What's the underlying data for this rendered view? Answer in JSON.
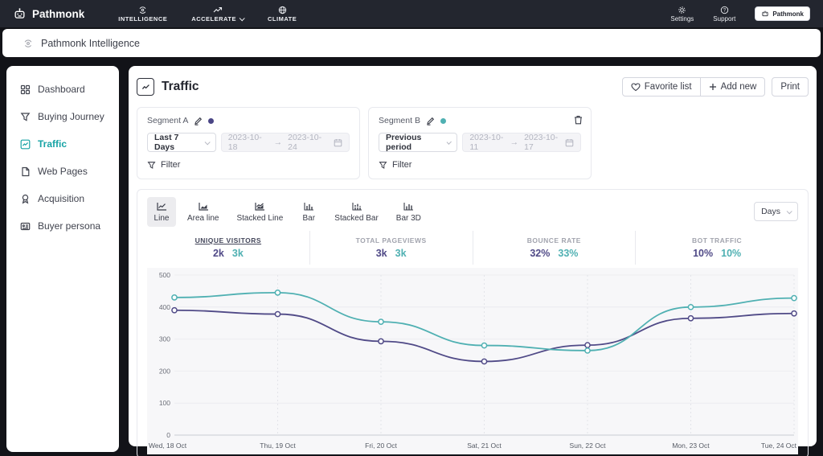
{
  "colors": {
    "accent_teal": "#4FB0B2",
    "accent_purple": "#504A87",
    "sidebar_active": "#17A3A5"
  },
  "topbar": {
    "logo_text": "Pathmonk",
    "nav": [
      {
        "label": "INTELLIGENCE"
      },
      {
        "label": "ACCELERATE"
      },
      {
        "label": "CLIMATE"
      }
    ],
    "settings_label": "Settings",
    "support_label": "Support",
    "account_label": "Pathmonk"
  },
  "breadcrumb": {
    "label": "Pathmonk Intelligence"
  },
  "sidebar": {
    "items": [
      {
        "label": "Dashboard"
      },
      {
        "label": "Buying Journey"
      },
      {
        "label": "Traffic"
      },
      {
        "label": "Web Pages"
      },
      {
        "label": "Acquisition"
      },
      {
        "label": "Buyer persona"
      }
    ]
  },
  "header": {
    "title": "Traffic",
    "favorite_label": "Favorite list",
    "add_new_label": "Add new",
    "print_label": "Print"
  },
  "ui": {
    "range_arrow": "→"
  },
  "segments": [
    {
      "name": "Segment A",
      "dot_color": "#4A4585",
      "range_label": "Last 7 Days",
      "date_start": "2023-10-18",
      "date_end": "2023-10-24",
      "filter_label": "Filter"
    },
    {
      "name": "Segment B",
      "dot_color": "#4FB0B2",
      "range_label": "Previous period",
      "date_start": "2023-10-11",
      "date_end": "2023-10-17",
      "filter_label": "Filter"
    }
  ],
  "chart_controls": {
    "tabs": [
      {
        "label": "Line"
      },
      {
        "label": "Area line"
      },
      {
        "label": "Stacked Line"
      },
      {
        "label": "Bar"
      },
      {
        "label": "Stacked Bar"
      },
      {
        "label": "Bar 3D"
      }
    ],
    "interval": "Days"
  },
  "metrics": [
    {
      "label": "UNIQUE VISITORS",
      "value_a": "2k",
      "value_b": "3k",
      "selected": true
    },
    {
      "label": "TOTAL PAGEVIEWS",
      "value_a": "3k",
      "value_b": "3k",
      "selected": false
    },
    {
      "label": "BOUNCE RATE",
      "value_a": "32%",
      "value_b": "33%",
      "selected": false
    },
    {
      "label": "BOT TRAFFIC",
      "value_a": "10%",
      "value_b": "10%",
      "selected": false
    }
  ],
  "chart_data": {
    "type": "line",
    "x": [
      "Wed, 18 Oct",
      "Thu, 19 Oct",
      "Fri, 20 Oct",
      "Sat, 21 Oct",
      "Sun, 22 Oct",
      "Mon, 23 Oct",
      "Tue, 24 Oct"
    ],
    "series": [
      {
        "name": "Segment A",
        "color": "#504A87",
        "values": [
          390,
          378,
          293,
          230,
          281,
          365,
          380
        ]
      },
      {
        "name": "Segment B",
        "color": "#4FB0B2",
        "values": [
          430,
          445,
          354,
          280,
          264,
          400,
          428
        ]
      }
    ],
    "title": "",
    "xlabel": "",
    "ylabel": "",
    "ylim": [
      0,
      500
    ],
    "yticks": [
      0,
      100,
      200,
      300,
      400,
      500
    ],
    "grid": true,
    "legend": false,
    "marker": "open-circle"
  }
}
